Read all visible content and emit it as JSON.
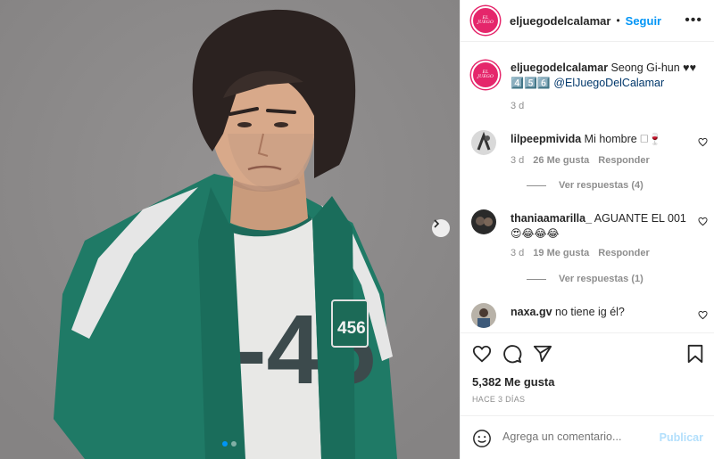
{
  "post": {
    "account": "eljuegodelcalamar",
    "follow_label": "Seguir",
    "separator": "•",
    "more_label": "•••",
    "caption": {
      "user": "eljuegodelcalamar",
      "text": " Seong Gi-hun ♥♥",
      "numbers": "4️⃣5️⃣6️⃣",
      "mention": "@ElJuegoDelCalamar",
      "age": "3 d"
    },
    "image": {
      "jersey_number": "456",
      "shirt_number": "-45"
    },
    "carousel": {
      "count": 2,
      "active": 0
    }
  },
  "comments": [
    {
      "user": "lilpeepmivida",
      "text": " Mi hombre 🗆🍷",
      "age": "3 d",
      "likes": "26 Me gusta",
      "reply": "Responder",
      "view_replies": "Ver respuestas (4)"
    },
    {
      "user": "thaniaamarilla_",
      "text": " AGUANTE EL 001",
      "emojis": "😍😂😂😂",
      "age": "3 d",
      "likes": "19 Me gusta",
      "reply": "Responder",
      "view_replies": "Ver respuestas (1)"
    },
    {
      "user": "naxa.gv",
      "text": " no tiene ig él?",
      "age": "",
      "likes": "",
      "reply": "",
      "view_replies": ""
    }
  ],
  "stats": {
    "likes": "5,382 Me gusta",
    "time_ago": "HACE 3 DÍAS"
  },
  "add_comment": {
    "placeholder": "Agrega un comentario...",
    "post_label": "Publicar"
  },
  "colors": {
    "accent": "#0095f6",
    "brand": "#e5266b",
    "jacket": "#1f7a66",
    "background": "#8c8a8a"
  }
}
